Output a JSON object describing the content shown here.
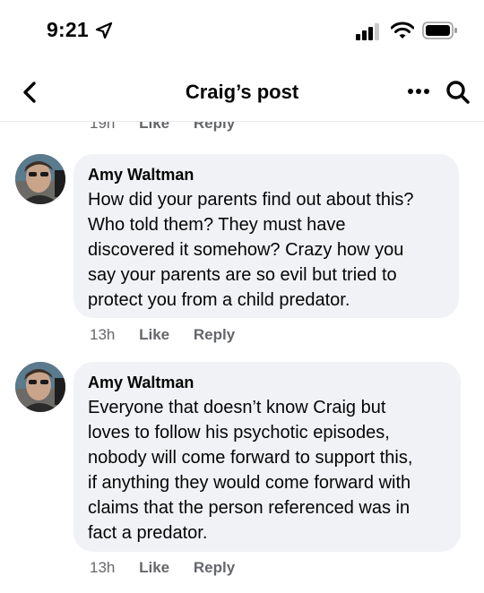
{
  "status": {
    "time": "9:21"
  },
  "nav": {
    "title": "Craig’s post"
  },
  "previous_comment": {
    "time": "19h",
    "like": "Like",
    "reply": "Reply"
  },
  "comments": [
    {
      "author": "Amy Waltman",
      "lines": [
        "How did your parents find out about this?",
        "Who told them? They must have",
        "discovered it somehow? Crazy how you",
        "say your parents are so evil but tried to",
        "protect you from a child predator."
      ],
      "time": "13h",
      "like": "Like",
      "reply": "Reply"
    },
    {
      "author": "Amy Waltman",
      "lines": [
        "Everyone that doesn’t know Craig but",
        "loves to follow his psychotic episodes,",
        "nobody will come forward to support this,",
        "if anything they would come forward with",
        "claims that the person referenced was in",
        "fact a predator."
      ],
      "time": "13h",
      "like": "Like",
      "reply": "Reply"
    }
  ]
}
